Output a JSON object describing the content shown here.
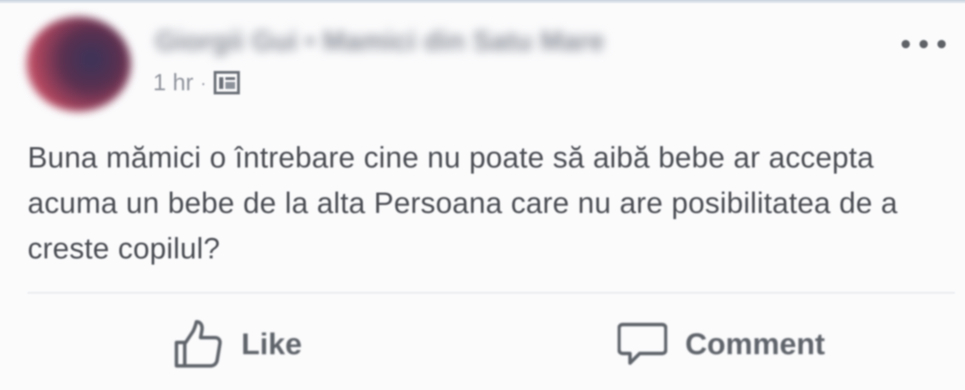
{
  "post": {
    "author": "Giorgii Gui • Mamici din Satu Mare",
    "time": "1 hr",
    "separator": "·",
    "privacy_icon": "group-privacy-icon",
    "more_icon": "more-options-icon",
    "text": "Buna mămici o întrebare cine nu poate să aibă bebe ar accepta acuma un bebe de la alta Persoana care nu are posibilitatea de a creste copilul?"
  },
  "actions": {
    "like_label": "Like",
    "like_icon": "thumbs-up-icon",
    "comment_label": "Comment",
    "comment_icon": "speech-bubble-icon"
  }
}
